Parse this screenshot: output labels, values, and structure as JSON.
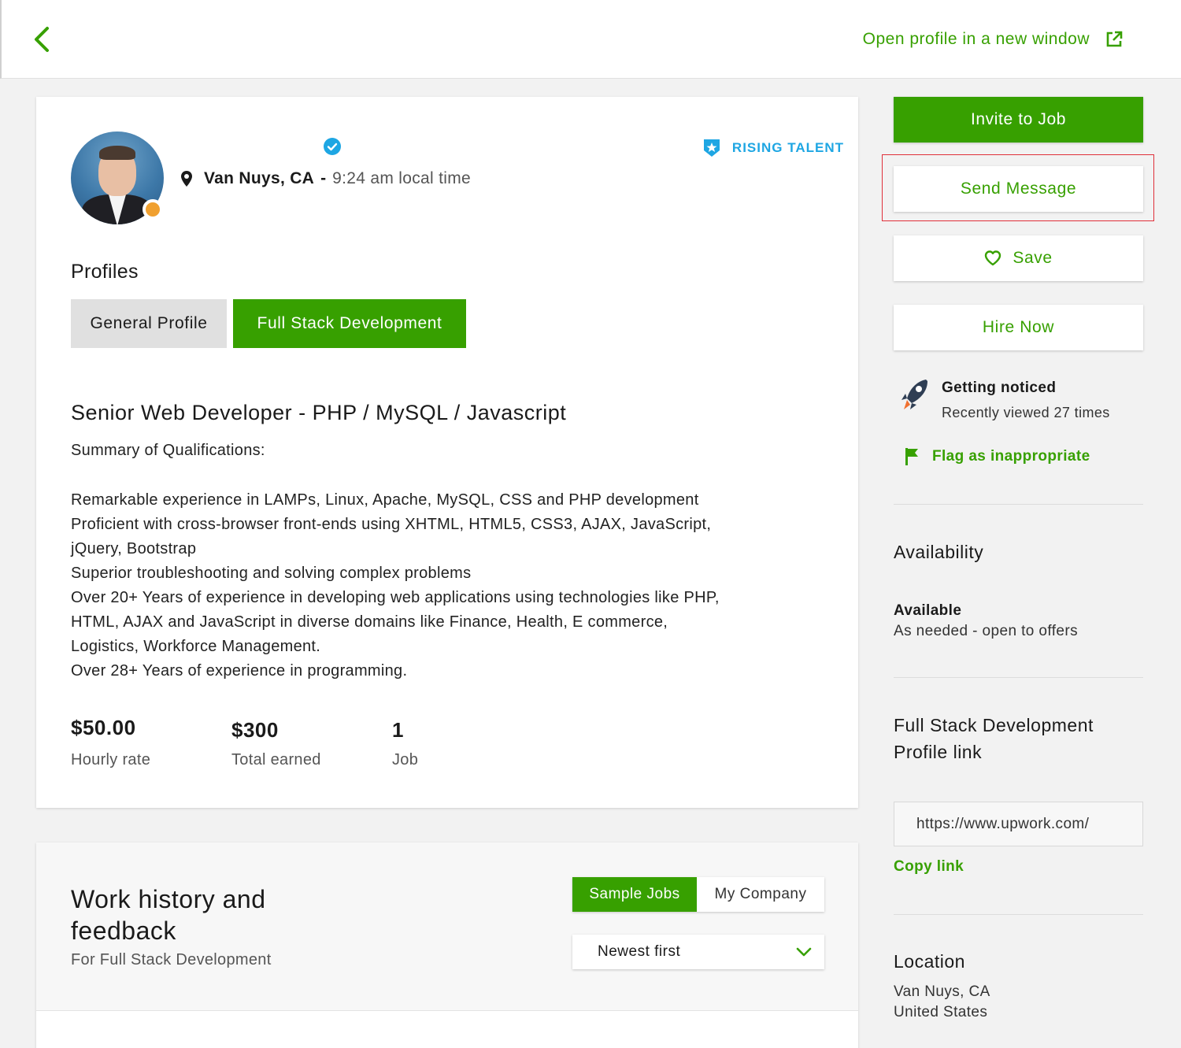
{
  "topbar": {
    "open_profile_label": "Open profile in a new window"
  },
  "profile": {
    "city": "Van Nuys, CA",
    "separator": "-",
    "local_time": "9:24 am local time",
    "badge": "RISING TALENT",
    "profiles_heading": "Profiles",
    "tabs": [
      {
        "label": "General Profile",
        "active": false
      },
      {
        "label": "Full Stack Development",
        "active": true
      }
    ],
    "job_title": "Senior Web Developer - PHP / MySQL / Javascript",
    "summary_heading": "Summary of Qualifications:",
    "description_lines": [
      "Remarkable experience in LAMPs, Linux, Apache, MySQL, CSS and PHP development",
      "Proficient with cross-browser front-ends using XHTML, HTML5, CSS3, AJAX, JavaScript,",
      "jQuery, Bootstrap",
      "Superior troubleshooting and solving complex problems",
      "Over 20+ Years of experience in developing web applications using technologies like PHP,",
      "HTML, AJAX and JavaScript in diverse domains like Finance, Health, E commerce,",
      "Logistics, Workforce Management.",
      "Over 28+ Years of experience in programming."
    ],
    "stats": [
      {
        "value": "$50.00",
        "label": "Hourly rate"
      },
      {
        "value": "$300",
        "label": "Total earned"
      },
      {
        "value": "1",
        "label": "Job"
      }
    ]
  },
  "work_history": {
    "title": "Work history and feedback",
    "subtitle": "For Full Stack Development",
    "segments": [
      {
        "label": "Sample Jobs",
        "active": true
      },
      {
        "label": "My Company",
        "active": false
      }
    ],
    "sort_selected": "Newest first"
  },
  "sidebar": {
    "invite_label": "Invite to Job",
    "message_label": "Send Message",
    "save_label": "Save",
    "hire_label": "Hire Now",
    "noticed_title": "Getting noticed",
    "noticed_text": "Recently viewed 27 times",
    "flag_label": "Flag as inappropriate",
    "availability_heading": "Availability",
    "availability_status": "Available",
    "availability_detail": "As needed - open to offers",
    "profile_link_heading_1": "Full Stack Development",
    "profile_link_heading_2": "Profile link",
    "profile_link_value": "https://www.upwork.com/",
    "copy_link_label": "Copy link",
    "location_heading": "Location",
    "location_city": "Van Nuys, CA",
    "location_country": "United States"
  },
  "colors": {
    "brand_green": "#37a000",
    "rising_blue": "#1ea6e3",
    "status_orange": "#f0a030",
    "highlight_red": "#e0303a"
  },
  "icons": [
    "chevron-left-icon",
    "external-link-icon",
    "verified-check-icon",
    "map-pin-icon",
    "rising-talent-badge-icon",
    "heart-icon",
    "rocket-icon",
    "flag-icon",
    "chevron-down-icon"
  ]
}
